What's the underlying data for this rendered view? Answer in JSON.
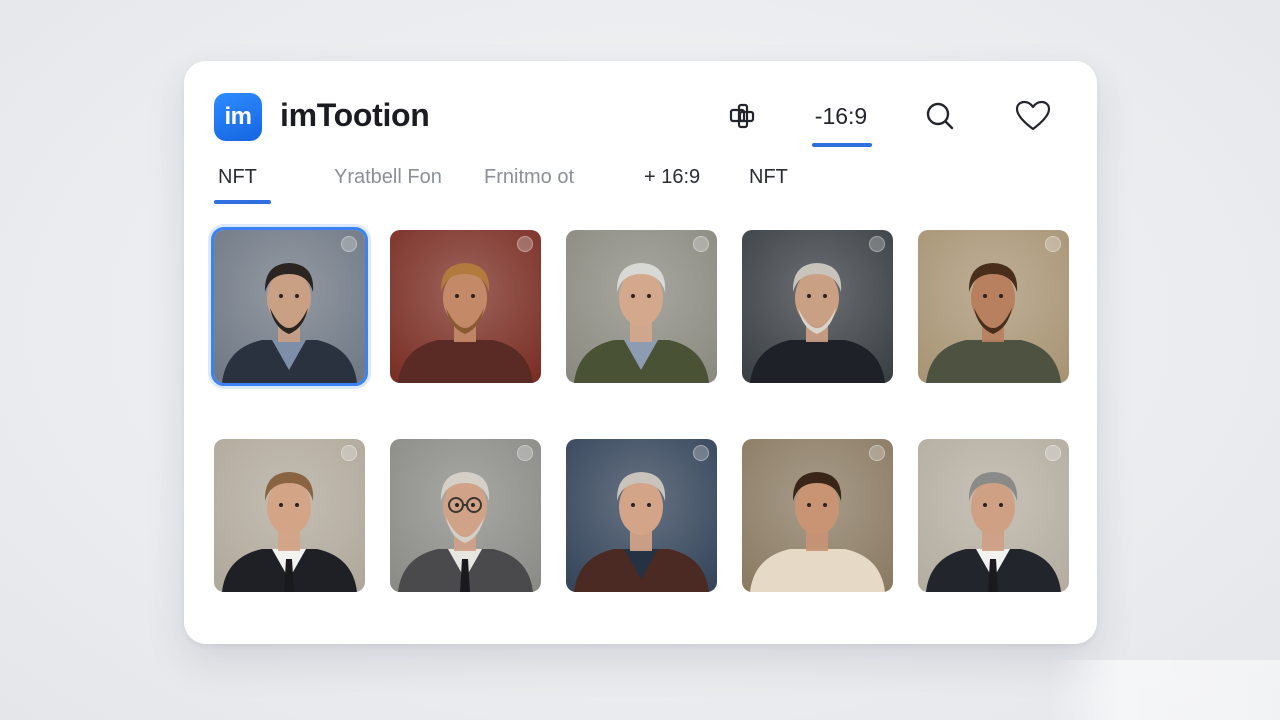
{
  "app": {
    "logo_text": "im",
    "title": "imTootion"
  },
  "header": {
    "layers_icon": "layers-icon",
    "ratio_label": "-16:9",
    "search_icon": "search-icon",
    "heart_icon": "heart-icon"
  },
  "tabs": [
    {
      "label": "NFT",
      "active": true
    },
    {
      "label": "Yratbell Fon",
      "active": false
    },
    {
      "label": "Frnitmo ot",
      "active": false
    },
    {
      "label": "+ 16:9",
      "active": false
    },
    {
      "label": "NFT",
      "active": false
    }
  ],
  "accent_color": "#2f6fe0",
  "gallery": [
    {
      "subject": "bearded man in dark jacket",
      "bg": "#6f7884",
      "skin": "#c9a084",
      "hair": "#2b2420",
      "beard": "#2b2420",
      "cloth": "#2a3240",
      "shirt": "#7d8ea8",
      "selected": true
    },
    {
      "subject": "man with wavy blond hair",
      "bg": "#7a2e24",
      "skin": "#c48a68",
      "hair": "#b27a3c",
      "beard": "#8a5a30",
      "cloth": "#5a2a24",
      "shirt": "#5a2a24",
      "selected": false
    },
    {
      "subject": "older man with grey hair",
      "bg": "#8a8a80",
      "skin": "#d4a88c",
      "hair": "#d8d8d4",
      "beard": "",
      "cloth": "#4a5236",
      "shirt": "#8e9cb2",
      "selected": false
    },
    {
      "subject": "older man with white beard",
      "bg": "#3a3f44",
      "skin": "#caa084",
      "hair": "#c8c4bc",
      "beard": "#d8d4cc",
      "cloth": "#1e2228",
      "shirt": "#1e2228",
      "selected": false
    },
    {
      "subject": "man with curly hair and beard",
      "bg": "#a89474",
      "skin": "#b8805e",
      "hair": "#4a2e1c",
      "beard": "#4a2e1c",
      "cloth": "#4e5240",
      "shirt": "#4e5240",
      "selected": false
    },
    {
      "subject": "man in suit and tie",
      "bg": "#b0a89a",
      "skin": "#d4a486",
      "hair": "#8a6440",
      "beard": "",
      "cloth": "#1e2026",
      "shirt": "#f2f2f0",
      "selected": false
    },
    {
      "subject": "older man with glasses",
      "bg": "#8a8a86",
      "skin": "#d0a288",
      "hair": "#d4d0c8",
      "beard": "#d4d0c8",
      "cloth": "#4a4a4c",
      "shirt": "#e8e6e0",
      "selected": false
    },
    {
      "subject": "older man in brown jacket",
      "bg": "#34445a",
      "skin": "#d4a488",
      "hair": "#c8c4bc",
      "beard": "",
      "cloth": "#4a2a22",
      "shirt": "#243244",
      "selected": false
    },
    {
      "subject": "young man with curly hair",
      "bg": "#8a7a62",
      "skin": "#c89474",
      "hair": "#3a2618",
      "beard": "",
      "cloth": "#e6dac6",
      "shirt": "#e6dac6",
      "selected": false
    },
    {
      "subject": "grey-haired man in suit",
      "bg": "#b4ada0",
      "skin": "#cfa084",
      "hair": "#8a8a88",
      "beard": "",
      "cloth": "#22252c",
      "shirt": "#f2f2f0",
      "selected": false
    }
  ]
}
